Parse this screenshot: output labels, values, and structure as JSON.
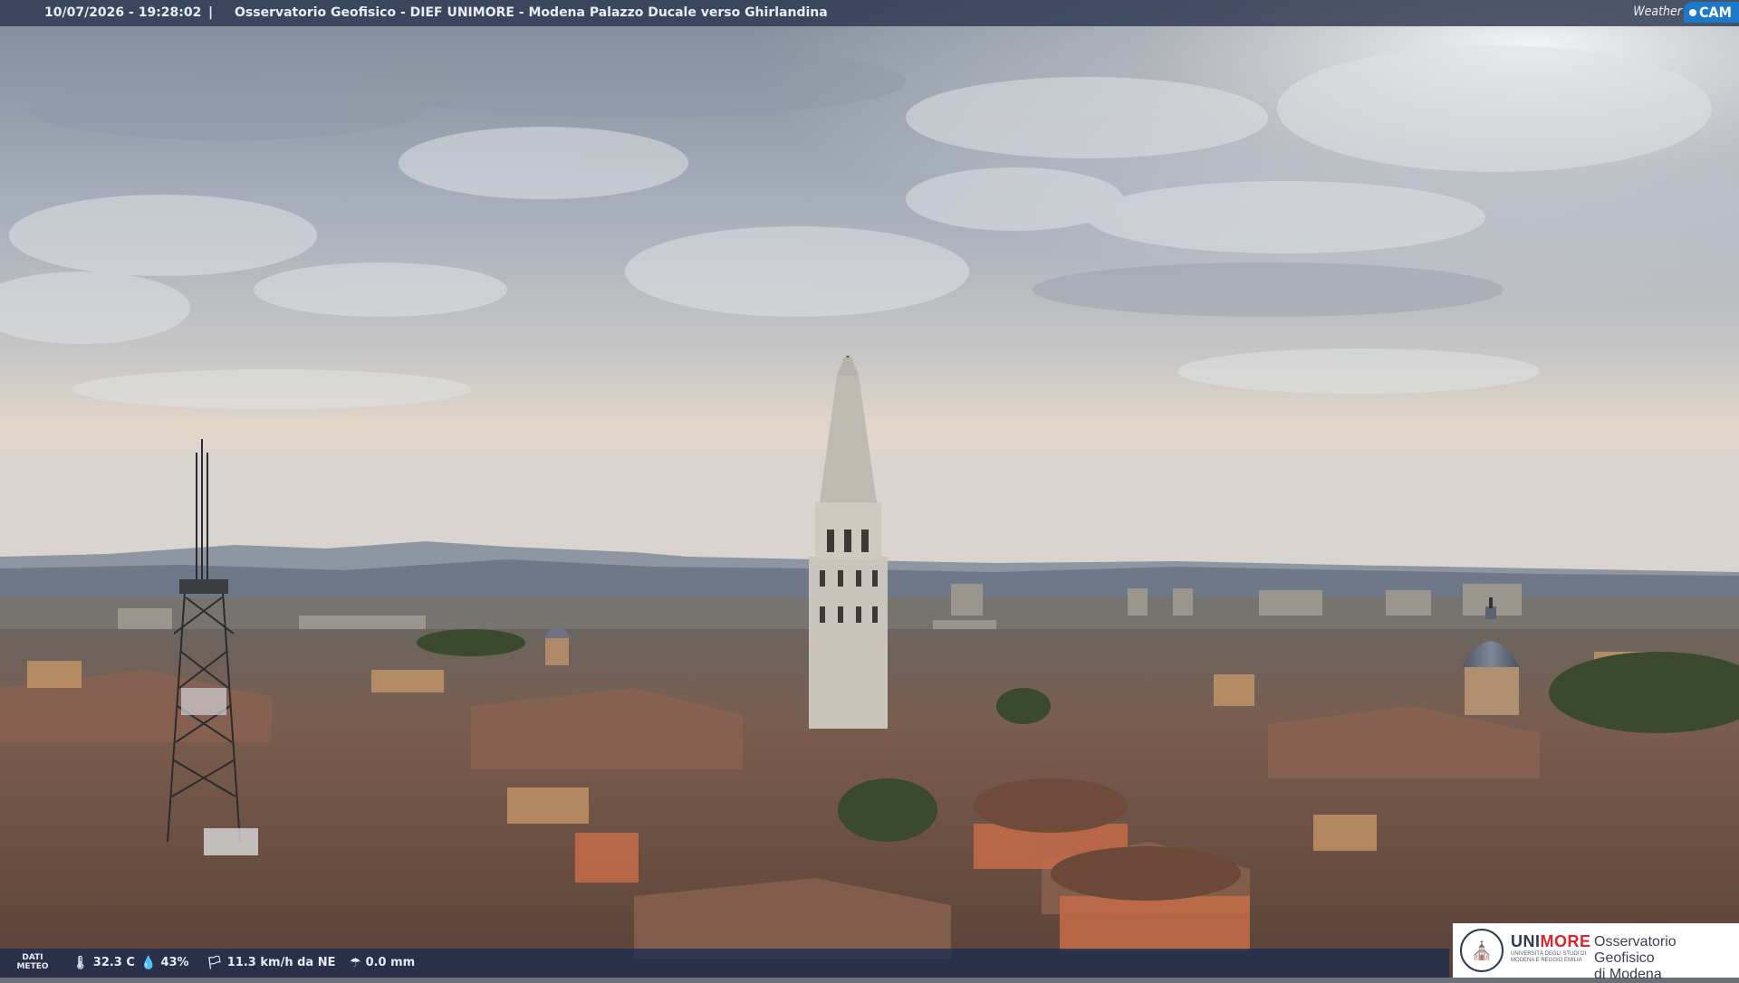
{
  "header": {
    "timestamp": "10/07/2026 - 19:28:02",
    "separator": "|",
    "title": "Osservatorio Geofisico - DIEF UNIMORE - Modena Palazzo Ducale verso Ghirlandina"
  },
  "weathercam_logo": {
    "weather": "Weather",
    "cam": "CAM"
  },
  "weather_data": {
    "label_line1": "DATI",
    "label_line2": "METEO",
    "temperature": "32.3 C",
    "humidity": "43%",
    "wind": "11.3 km/h da NE",
    "rain": "0.0 mm",
    "icons": [
      "thermometer-icon",
      "humidity-drop-icon",
      "wind-icon",
      "rain-icon"
    ]
  },
  "logo": {
    "uni": "UNI",
    "more": "MORE",
    "university_name": "UNIVERSITÀ DEGLI STUDI DI MODENA E REGGIO EMILIA",
    "observatory": "Osservatorio Geofisico",
    "city": "di Modena"
  },
  "colors": {
    "top_bar": "#28344e",
    "bottom_bar": "#1c2c50",
    "cam_accent": "#1c78c8",
    "unimore_red": "#d7262c",
    "unimore_blue": "#2e3a52"
  }
}
